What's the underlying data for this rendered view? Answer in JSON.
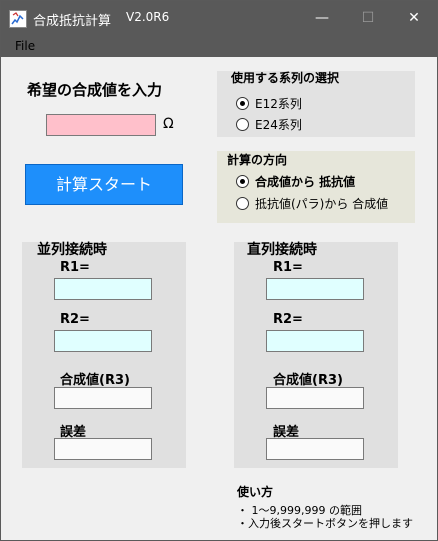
{
  "window": {
    "title": "合成抵抗計算",
    "version": "V2.0R6",
    "minimize": "—",
    "maximize": "☐",
    "close": "✕"
  },
  "menu": {
    "file": "File"
  },
  "input": {
    "heading": "希望の合成値を入力",
    "value": "",
    "unit": "Ω"
  },
  "start_button": "計算スタート",
  "series_group": {
    "title": "使用する系列の選択",
    "options": [
      {
        "label": "E12系列",
        "selected": true
      },
      {
        "label": "E24系列",
        "selected": false
      }
    ]
  },
  "direction_group": {
    "title": "計算の方向",
    "options": [
      {
        "label": "合成値から 抵抗値",
        "selected": true
      },
      {
        "label": "抵抗値(パラ)から 合成値",
        "selected": false
      }
    ]
  },
  "parallel": {
    "title": "並列接続時",
    "r1_label": "R1=",
    "r1_value": "",
    "r2_label": "R2=",
    "r2_value": "",
    "r3_label": "合成値(R3)",
    "r3_value": "",
    "error_label": "誤差",
    "error_value": ""
  },
  "series": {
    "title": "直列接続時",
    "r1_label": "R1=",
    "r1_value": "",
    "r2_label": "R2=",
    "r2_value": "",
    "r3_label": "合成値(R3)",
    "r3_value": "",
    "error_label": "誤差",
    "error_value": ""
  },
  "usage": {
    "title": "使い方",
    "lines": [
      "・ 1～9,999,999 の範囲",
      "・入力後スタートボタンを押します"
    ]
  },
  "colors": {
    "titlebar": "#595959",
    "input_bg": "#ffc0cb",
    "start_button": "#1e8ffb",
    "result_bg": "#e0ffff"
  }
}
